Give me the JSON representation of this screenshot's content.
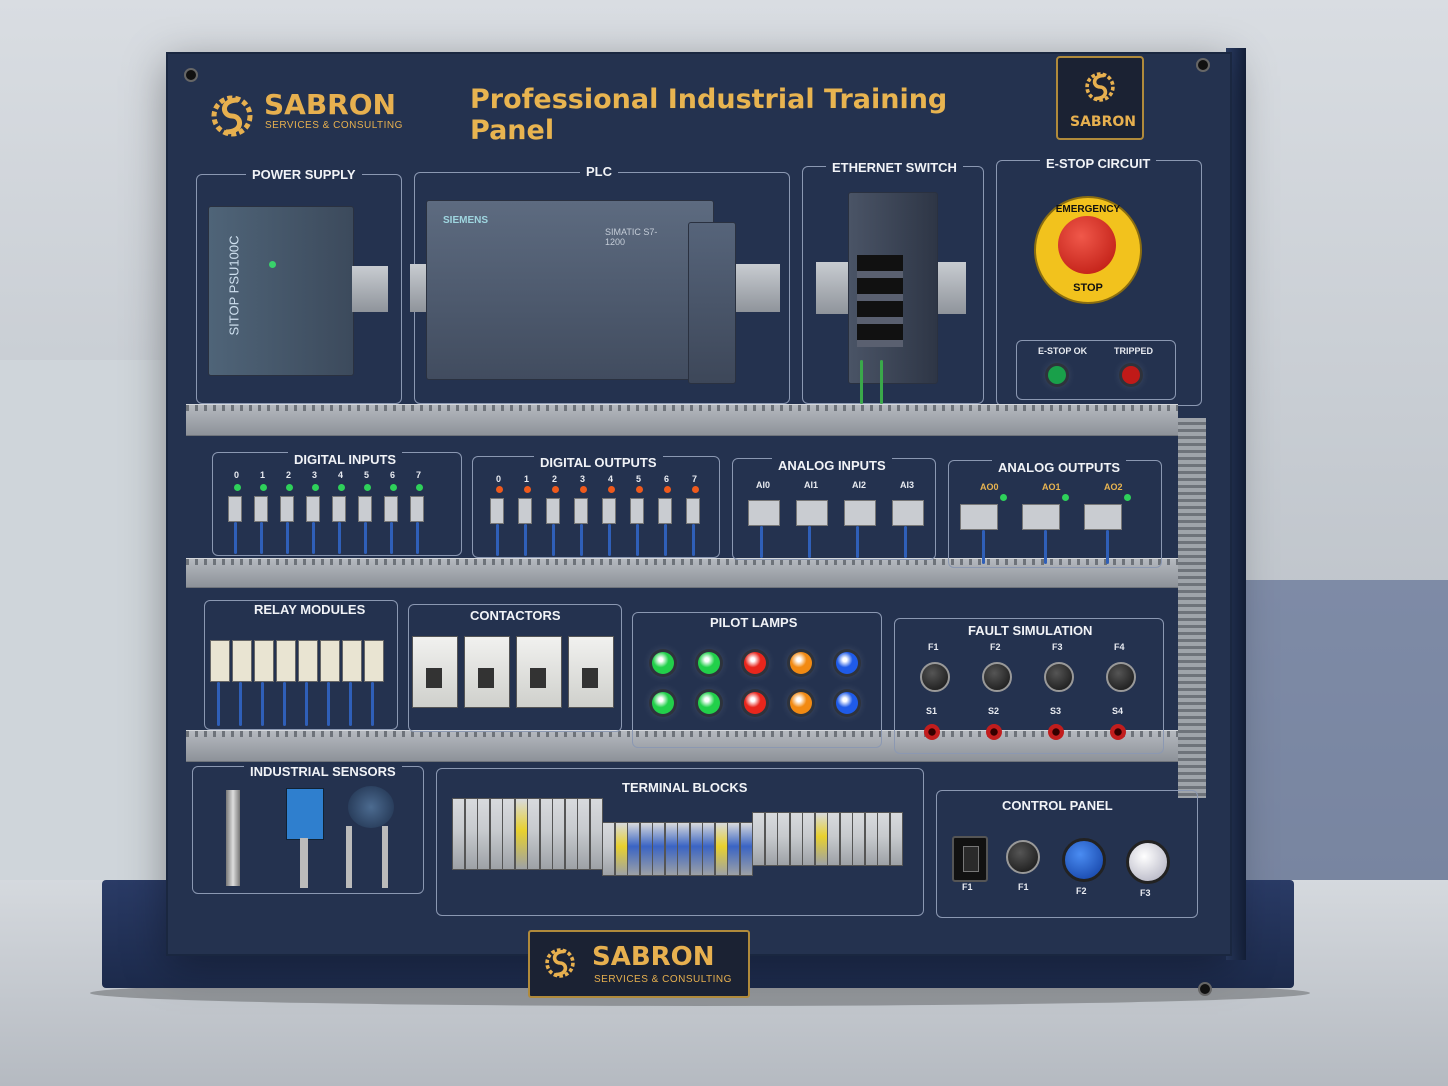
{
  "header": {
    "title": "Professional Industrial Training Panel",
    "brand_name": "SABRON",
    "brand_sub": "SERVICES & CONSULTING",
    "badge_name": "SABRON"
  },
  "sections": {
    "power_supply": "POWER SUPPLY",
    "plc": "PLC",
    "ethernet_switch": "ETHERNET SWITCH",
    "estop_circuit": "E-STOP CIRCUIT",
    "digital_inputs": "DIGITAL INPUTS",
    "digital_outputs": "DIGITAL OUTPUTS",
    "analog_inputs": "ANALOG INPUTS",
    "analog_outputs": "ANALOG OUTPUTS",
    "relay_modules": "RELAY MODULES",
    "contactors": "CONTACTORS",
    "pilot_lamps": "PILOT LAMPS",
    "fault_simulation": "FAULT SIMULATION",
    "industrial_sensors": "INDUSTRIAL SENSORS",
    "terminal_blocks": "TERMINAL BLOCKS",
    "control_panel": "CONTROL PANEL"
  },
  "devices": {
    "psu_label": "SITOP PSU100C",
    "plc_brand": "SIEMENS",
    "plc_model": "SIMATIC S7-1200",
    "estop_top": "EMERGENCY",
    "estop_bottom": "STOP",
    "estop_ok": "E-STOP OK",
    "tripped": "TRIPPED"
  },
  "io": {
    "di_numbers": [
      "0",
      "1",
      "2",
      "3",
      "4",
      "5",
      "6",
      "7"
    ],
    "do_numbers": [
      "0",
      "1",
      "2",
      "3",
      "4",
      "5",
      "6",
      "7"
    ],
    "ai_labels": [
      "AI0",
      "AI1",
      "AI2",
      "AI3"
    ],
    "ao_labels": [
      "AO0",
      "AO1",
      "AO2"
    ]
  },
  "fault": {
    "knobs": [
      "F1",
      "F2",
      "F3",
      "F4"
    ],
    "switches": [
      "S1",
      "S2",
      "S3",
      "S4"
    ]
  },
  "control": {
    "labels": [
      "F1",
      "F1",
      "F2",
      "F3"
    ]
  },
  "footer": {
    "brand_name": "SABRON",
    "brand_sub": "SERVICES & CONSULTING"
  },
  "colors": {
    "panel": "#24324f",
    "accent": "#e8b450",
    "lamp_green": "#22d04a",
    "lamp_red": "#e8261c",
    "lamp_orange": "#f28a12",
    "lamp_blue": "#1f5be8"
  }
}
